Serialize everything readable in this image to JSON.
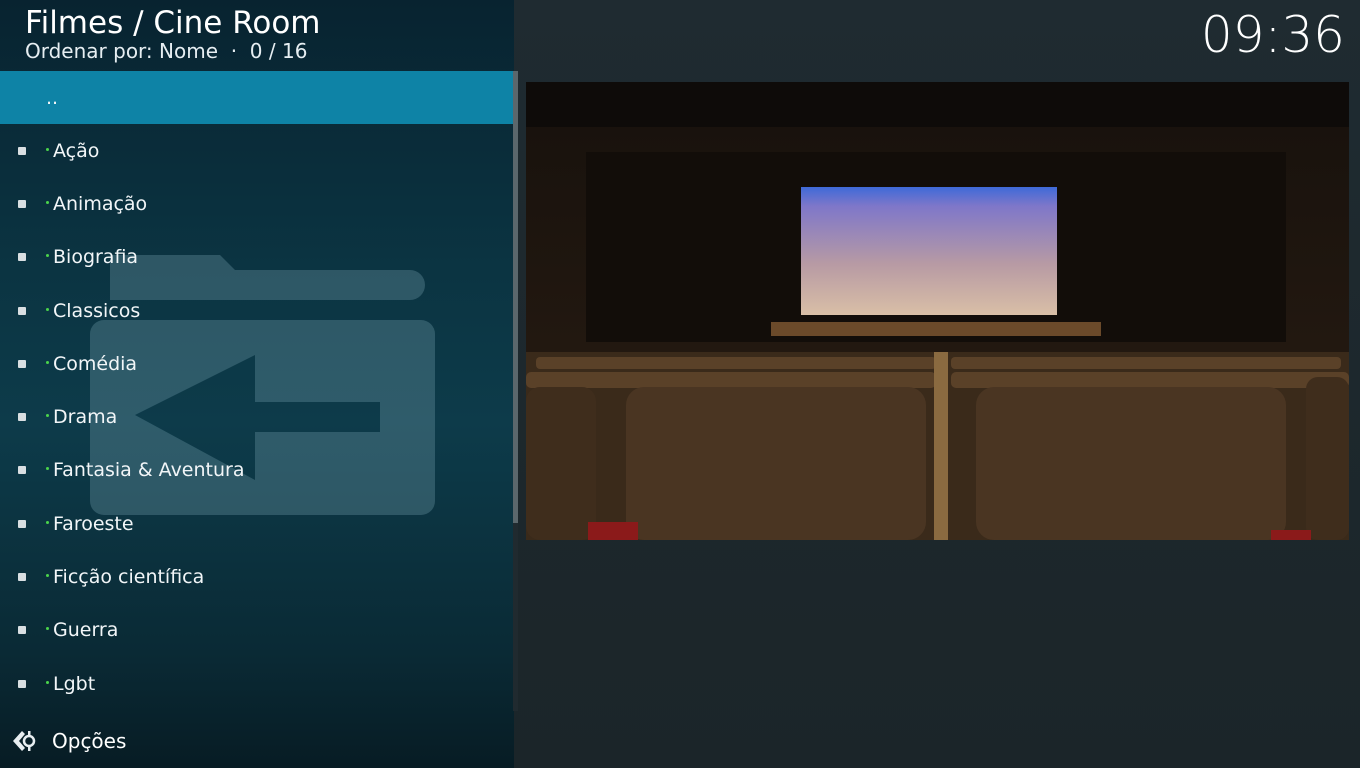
{
  "header": {
    "title": "Filmes / Cine Room",
    "subtitle": "Ordenar por: Nome  ·  0 / 16",
    "clock": "09:36"
  },
  "list": {
    "parent": "..",
    "items": [
      "Ação",
      "Animação",
      "Biografia",
      "Classicos",
      "Comédia",
      "Drama",
      "Fantasia & Aventura",
      "Faroeste",
      "Ficção científica",
      "Guerra",
      "Lgbt"
    ]
  },
  "footer": {
    "options_label": "Opções"
  },
  "colors": {
    "focus": "#0e83a6",
    "panel": "#0d3b4a",
    "accent_dot": "#4bd44b"
  },
  "icons": {
    "background": "folder-back-icon",
    "options": "options-arrow-icon"
  }
}
